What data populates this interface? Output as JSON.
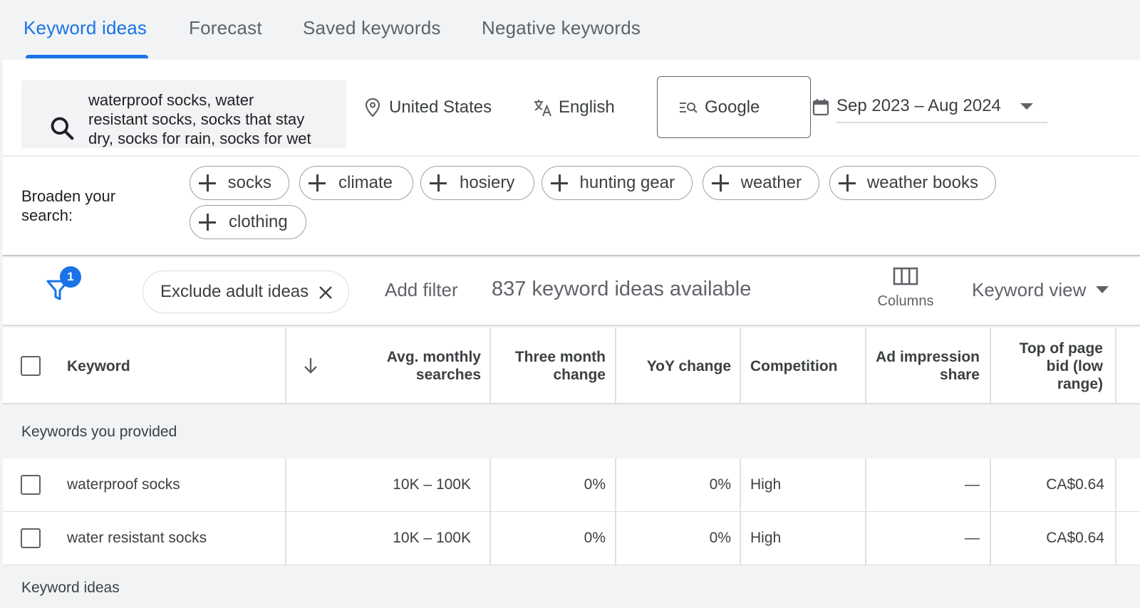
{
  "tabs": [
    {
      "label": "Keyword ideas",
      "active": true
    },
    {
      "label": "Forecast",
      "active": false
    },
    {
      "label": "Saved keywords",
      "active": false
    },
    {
      "label": "Negative keywords",
      "active": false
    }
  ],
  "search": {
    "query_line1": "waterproof socks, water",
    "query_line2": "resistant socks, socks that stay",
    "query_line3": "dry, socks for rain, socks for wet",
    "location": "United States",
    "language": "English",
    "network": "Google",
    "date_range": "Sep 2023 – Aug 2024"
  },
  "broaden": {
    "label_line1": "Broaden your",
    "label_line2": "search:",
    "chips": [
      "socks",
      "climate",
      "hosiery",
      "hunting gear",
      "weather",
      "weather books",
      "clothing"
    ]
  },
  "filter_bar": {
    "filter_count": "1",
    "exclude_chip": "Exclude adult ideas",
    "add_filter": "Add filter",
    "ideas_available": "837 keyword ideas available",
    "columns_label": "Columns",
    "view_label": "Keyword view"
  },
  "table": {
    "headers": {
      "keyword": "Keyword",
      "avg_line1": "Avg. monthly",
      "avg_line2": "searches",
      "three_line1": "Three month",
      "three_line2": "change",
      "yoy": "YoY change",
      "competition": "Competition",
      "ad_line1": "Ad impression",
      "ad_line2": "share",
      "bid_line1": "Top of page",
      "bid_line2": "bid (low",
      "bid_line3": "range)"
    },
    "section_provided": "Keywords you provided",
    "section_ideas": "Keyword ideas",
    "rows": [
      {
        "keyword": "waterproof socks",
        "avg": "10K – 100K",
        "three_month": "0%",
        "yoy": "0%",
        "competition": "High",
        "ad_share": "—",
        "bid_low": "CA$0.64"
      },
      {
        "keyword": "water resistant socks",
        "avg": "10K – 100K",
        "three_month": "0%",
        "yoy": "0%",
        "competition": "High",
        "ad_share": "—",
        "bid_low": "CA$0.64"
      }
    ]
  },
  "colors": {
    "accent": "#1a73e8",
    "text": "#202124",
    "muted": "#5f6368",
    "background": "#f1f3f4"
  },
  "icons": [
    "search-icon",
    "location-pin-icon",
    "translate-icon",
    "search-network-icon",
    "calendar-icon",
    "chevron-down-icon",
    "plus-icon",
    "filter-icon",
    "close-icon",
    "columns-icon",
    "arrow-down-icon"
  ]
}
